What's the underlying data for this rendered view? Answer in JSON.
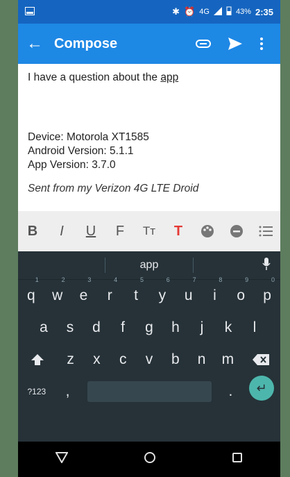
{
  "statusbar": {
    "network_label": "4G",
    "battery_percent": "43%",
    "time": "2:35"
  },
  "appbar": {
    "title": "Compose"
  },
  "message": {
    "line1_prefix": "I have a question about the ",
    "line1_link": "app",
    "device": "Device: Motorola XT1585",
    "android": "Android Version: 5.1.1",
    "app_version": "App Version: 3.7.0",
    "signature": "Sent from my Verizon 4G LTE Droid"
  },
  "format_bar": {
    "bold": "B",
    "italic": "I",
    "underline": "U",
    "font": "F",
    "text_size": "Tт",
    "text_color": "T",
    "colors": "#e53935"
  },
  "keyboard": {
    "suggestion": "app",
    "row1": [
      "q",
      "w",
      "e",
      "r",
      "t",
      "y",
      "u",
      "i",
      "o",
      "p"
    ],
    "row1_hints": [
      "1",
      "2",
      "3",
      "4",
      "5",
      "6",
      "7",
      "8",
      "9",
      "0"
    ],
    "row2": [
      "a",
      "s",
      "d",
      "f",
      "g",
      "h",
      "j",
      "k",
      "l"
    ],
    "row3": [
      "z",
      "x",
      "c",
      "v",
      "b",
      "n",
      "m"
    ],
    "symbols_key": "?123",
    "comma": ",",
    "period": "."
  }
}
